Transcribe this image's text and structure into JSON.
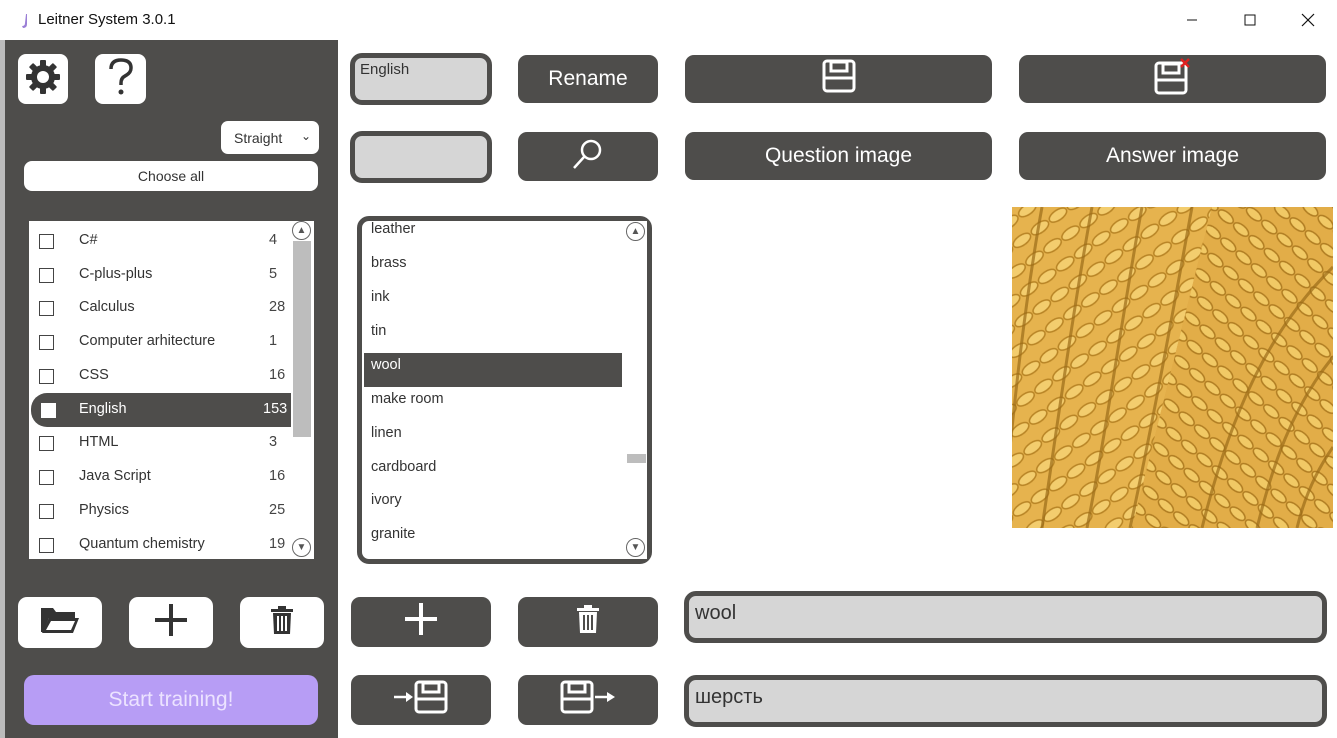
{
  "window": {
    "title": "Leitner System 3.0.1",
    "controls": [
      "minimize",
      "maximize",
      "close"
    ]
  },
  "sidebar": {
    "settings_icon": "gear-icon",
    "help_icon": "question-mark-icon",
    "mode_select": {
      "value": "Straight"
    },
    "choose_all_label": "Choose all",
    "decks": [
      {
        "name": "C#",
        "count": "4",
        "checked": false
      },
      {
        "name": "C-plus-plus",
        "count": "5",
        "checked": false
      },
      {
        "name": "Calculus",
        "count": "28",
        "checked": false
      },
      {
        "name": "Computer arhitecture",
        "count": "1",
        "checked": false
      },
      {
        "name": "CSS",
        "count": "16",
        "checked": false
      },
      {
        "name": "English",
        "count": "153",
        "checked": false,
        "selected": true
      },
      {
        "name": "HTML",
        "count": "3",
        "checked": false
      },
      {
        "name": "Java Script",
        "count": "16",
        "checked": false
      },
      {
        "name": "Physics",
        "count": "25",
        "checked": false
      },
      {
        "name": "Quantum chemistry",
        "count": "19",
        "checked": false
      }
    ],
    "actions": [
      "open-folder-icon",
      "plus-icon",
      "trash-icon"
    ],
    "start_label": "Start training!",
    "start_color": "#b79df5"
  },
  "editor": {
    "deck_name_value": "English",
    "search_value": "",
    "rename_label": "Rename",
    "question_image_label": "Question image",
    "answer_image_label": "Answer image",
    "cards": [
      "leather",
      "brass",
      "ink",
      "tin",
      "wool",
      "make room",
      "linen",
      "cardboard",
      "ivory",
      "granite"
    ],
    "selected_card": "wool",
    "question_value": "wool",
    "answer_value": "шерсть"
  },
  "colors": {
    "panel": "#4e4d4b",
    "field": "#d6d6d6",
    "accent": "#b79df5"
  }
}
